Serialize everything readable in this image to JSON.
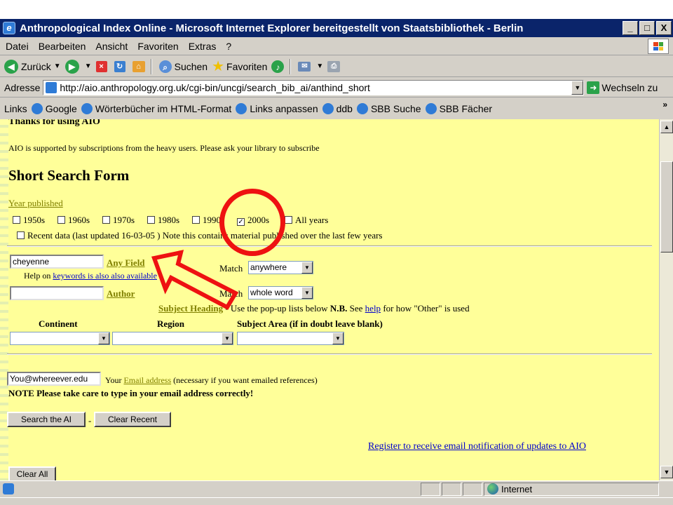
{
  "window": {
    "title": "Anthropological Index Online - Microsoft Internet Explorer bereitgestellt von Staatsbibliothek - Berlin",
    "min": "_",
    "max": "□",
    "close": "X"
  },
  "menu": [
    "Datei",
    "Bearbeiten",
    "Ansicht",
    "Favoriten",
    "Extras",
    "?"
  ],
  "toolbar": {
    "back": "Zurück",
    "search": "Suchen",
    "favorites": "Favoriten"
  },
  "address": {
    "label": "Adresse",
    "url": "http://aio.anthropology.org.uk/cgi-bin/uncgi/search_bib_ai/anthind_short",
    "go": "Wechseln zu"
  },
  "links": {
    "label": "Links",
    "items": [
      "Google",
      "Wörterbücher im HTML-Format",
      "Links anpassen",
      "ddb",
      "SBB Suche",
      "SBB Fächer"
    ],
    "more": "»"
  },
  "page": {
    "thanks": "Thanks for using AIO",
    "supported": "AIO is supported by subscriptions from the heavy users. Please ask your library to subscribe",
    "form_title": "Short Search Form",
    "year_published": "Year published",
    "years": [
      {
        "label": "1950s",
        "checked": false
      },
      {
        "label": "1960s",
        "checked": false
      },
      {
        "label": "1970s",
        "checked": false
      },
      {
        "label": "1980s",
        "checked": false
      },
      {
        "label": "1990s",
        "checked": false
      },
      {
        "label": "2000s",
        "checked": true
      },
      {
        "label": "All years",
        "checked": false
      }
    ],
    "recent_label": "Recent data (last updated 16-03-05 ) Note this contains material published over the last few years",
    "anyfield_value": "cheyenne",
    "anyfield_label": "Any Field",
    "help_prefix": "Help on",
    "help_link": "keywords is also also available",
    "match_label": "Match",
    "match1": "anywhere",
    "author_label": "Author",
    "match2": "whole word",
    "subject_heading": "Subject Heading",
    "subject_note_1": " - Use the pop-up lists below ",
    "subject_nb": "N.B.",
    "subject_note_2": " See ",
    "subject_help": "help",
    "subject_note_3": " for how \"Other\" is used",
    "continent": "Continent",
    "region": "Region",
    "subject_area": "Subject Area (if in doubt leave blank)",
    "email_value": "You@whereever.edu",
    "email_your": "Your ",
    "email_link": "Email address",
    "email_note": " (necessary if you want emailed references)",
    "email_warning": "NOTE Please take care to type in your email address correctly!",
    "search_btn": "Search the AI",
    "dash": "-",
    "clear_recent_btn": "Clear Recent",
    "register_link": "Register to receive email notification of updates to AIO",
    "clear_all_btn": "Clear All"
  },
  "status": {
    "zone": "Internet"
  },
  "colors": {
    "page_bg": "#ffff99",
    "annotation": "#ee1111",
    "titlebar": "#0a246a"
  }
}
